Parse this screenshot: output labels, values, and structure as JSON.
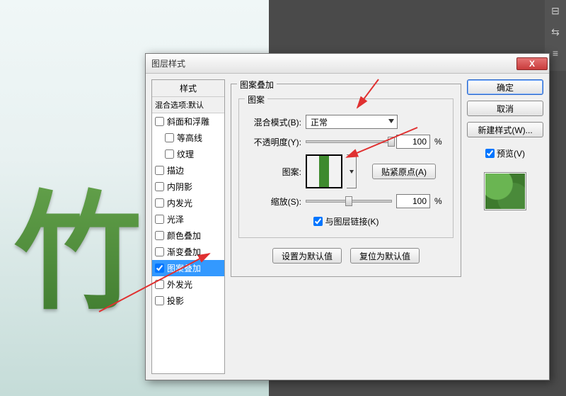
{
  "dialog": {
    "title": "图层样式",
    "close_x": "X"
  },
  "styles_panel": {
    "header": "样式",
    "sub": "混合选项:默认",
    "items": [
      {
        "label": "斜面和浮雕",
        "checked": false
      },
      {
        "label": "等高线",
        "checked": false,
        "indent": true
      },
      {
        "label": "纹理",
        "checked": false,
        "indent": true
      },
      {
        "label": "描边",
        "checked": false
      },
      {
        "label": "内阴影",
        "checked": false
      },
      {
        "label": "内发光",
        "checked": false
      },
      {
        "label": "光泽",
        "checked": false
      },
      {
        "label": "颜色叠加",
        "checked": false
      },
      {
        "label": "渐变叠加",
        "checked": false
      },
      {
        "label": "图案叠加",
        "checked": true,
        "selected": true
      },
      {
        "label": "外发光",
        "checked": false
      },
      {
        "label": "投影",
        "checked": false
      }
    ]
  },
  "pattern_overlay": {
    "group_title": "图案叠加",
    "inner_title": "图案",
    "blend_label": "混合模式(B):",
    "blend_value": "正常",
    "opacity_label": "不透明度(Y):",
    "opacity_value": "100",
    "pattern_label": "图案:",
    "snap_btn": "贴紧原点(A)",
    "scale_label": "缩放(S):",
    "scale_value": "100",
    "percent": "%",
    "link_label": "与图层链接(K)",
    "link_checked": true,
    "set_default_btn": "设置为默认值",
    "reset_default_btn": "复位为默认值"
  },
  "right": {
    "ok": "确定",
    "cancel": "取消",
    "new_style": "新建样式(W)...",
    "preview_label": "预览(V)",
    "preview_checked": true
  },
  "canvas_char": "竹"
}
